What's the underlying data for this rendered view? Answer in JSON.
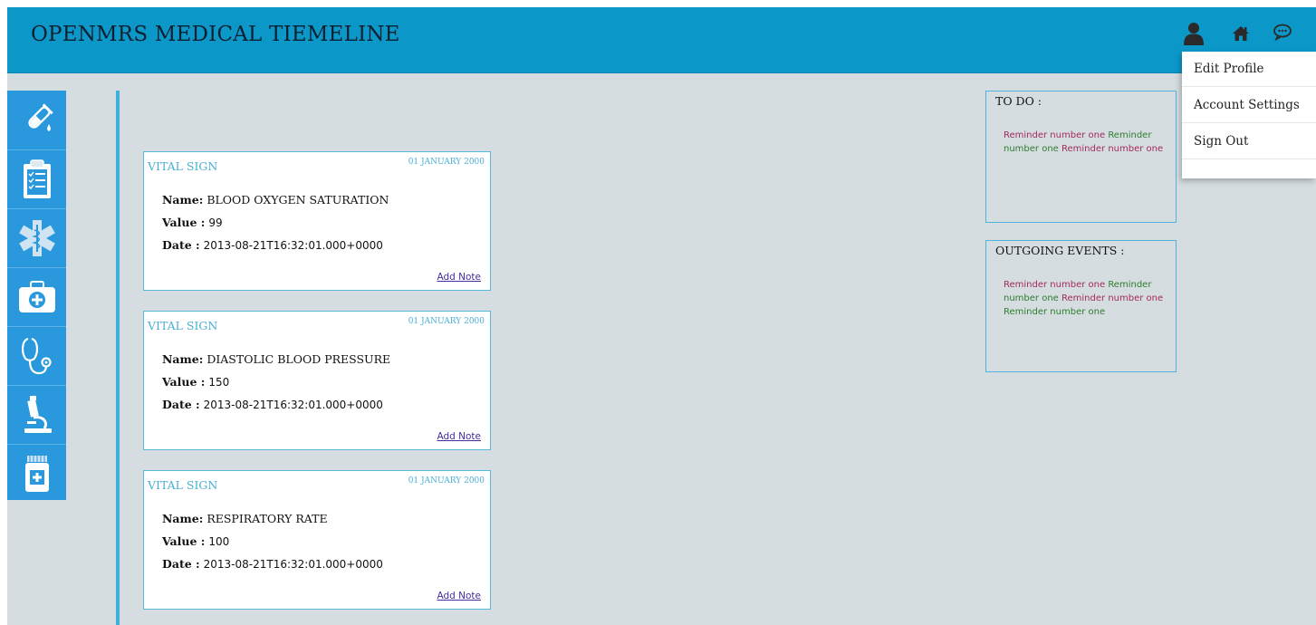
{
  "app": {
    "title": "OPENMRS MEDICAL TIEMELINE"
  },
  "header_icons": [
    "user-icon",
    "home-icon",
    "chat-icon"
  ],
  "user_menu": {
    "items": [
      {
        "label": "Edit Profile"
      },
      {
        "label": "Account Settings"
      },
      {
        "label": "Sign Out"
      }
    ]
  },
  "sidebar": {
    "items": [
      {
        "icon": "test-tube-icon"
      },
      {
        "icon": "clipboard-icon"
      },
      {
        "icon": "medical-star-icon"
      },
      {
        "icon": "first-aid-kit-icon"
      },
      {
        "icon": "stethoscope-icon"
      },
      {
        "icon": "microscope-icon"
      },
      {
        "icon": "medicine-bottle-icon"
      }
    ]
  },
  "cards": [
    {
      "type": "VITAL SIGN",
      "date": "01 JANUARY 2000",
      "name_label": "Name:",
      "name": "BLOOD OXYGEN SATURATION",
      "value_label": "Value :",
      "value": "99",
      "date_label": "Date :",
      "datetime": "2013-08-21T16:32:01.000+0000",
      "link": "Add Note"
    },
    {
      "type": "VITAL SIGN",
      "date": "01 JANUARY 2000",
      "name_label": "Name:",
      "name": "DIASTOLIC BLOOD PRESSURE",
      "value_label": "Value :",
      "value": "150",
      "date_label": "Date :",
      "datetime": "2013-08-21T16:32:01.000+0000",
      "link": "Add Note"
    },
    {
      "type": "VITAL SIGN",
      "date": "01 JANUARY 2000",
      "name_label": "Name:",
      "name": "RESPIRATORY RATE",
      "value_label": "Value :",
      "value": "100",
      "date_label": "Date :",
      "datetime": "2013-08-21T16:32:01.000+0000",
      "link": "Add Note"
    }
  ],
  "todo": {
    "title": "TO DO :",
    "reminders": [
      "Reminder number one",
      "Reminder number one",
      "Reminder number one"
    ]
  },
  "outgoing": {
    "title": "OUTGOING EVENTS :",
    "reminders": [
      "Reminder number one",
      "Reminder number one",
      "Reminder number one",
      "Reminder number one"
    ]
  },
  "colors": {
    "header": "#0c97c9",
    "sidebar": "#2a98dc",
    "accent": "#4cb0d8",
    "reminder_alt_1": "#a32a5c",
    "reminder_alt_2": "#2e7d2e"
  }
}
